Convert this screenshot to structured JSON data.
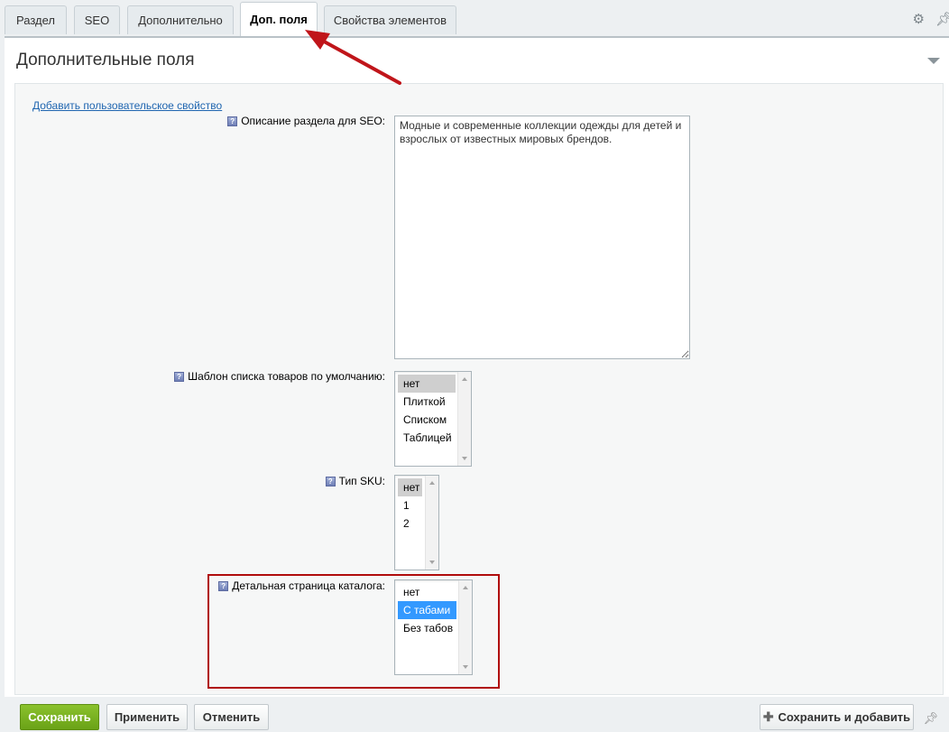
{
  "tabs": [
    {
      "label": "Раздел"
    },
    {
      "label": "SEO"
    },
    {
      "label": "Дополнительно"
    },
    {
      "label": "Доп. поля"
    },
    {
      "label": "Свойства элементов"
    }
  ],
  "tab_icons": {
    "settings": "gear-icon",
    "pin": "pin-icon"
  },
  "section": {
    "title": "Дополнительные поля",
    "add_link": "Добавить пользовательское свойство"
  },
  "fields": {
    "seo_description": {
      "label": "Описание раздела для SEO:",
      "value": "Модные и современные коллекции одежды для детей и взрослых от известных мировых брендов."
    },
    "list_template": {
      "label": "Шаблон списка товаров по умолчанию:",
      "options": [
        "нет",
        "Плиткой",
        "Списком",
        "Таблицей"
      ],
      "selected": "нет"
    },
    "sku_type": {
      "label": "Тип SKU:",
      "options": [
        "нет",
        "1",
        "2"
      ],
      "selected": "нет"
    },
    "catalog_detail": {
      "label": "Детальная страница каталога:",
      "options": [
        "нет",
        "С табами",
        "Без табов"
      ],
      "selected": "С табами"
    }
  },
  "footer": {
    "save": "Сохранить",
    "apply": "Применить",
    "cancel": "Отменить",
    "save_add": "Сохранить и добавить"
  },
  "colors": {
    "save_button": "#7ab321",
    "highlight_box": "#b00c0c",
    "annotation_arrow": "#c0151a",
    "link": "#2066b0",
    "selected_option": "#3399ff"
  }
}
